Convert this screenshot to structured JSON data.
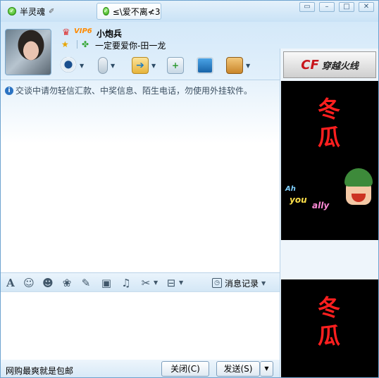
{
  "tabs": [
    {
      "label": "半灵魂",
      "icon": "online-status-icon",
      "extra": "✐"
    },
    {
      "label": "≤\\爱不离≮3",
      "icon": "online-status-icon"
    }
  ],
  "window_controls": [
    "restore-icon",
    "minimize-icon",
    "maximize-icon",
    "close-icon"
  ],
  "contact": {
    "vip_badge": "VIP6",
    "nickname": "小炮兵",
    "signature": "一定要爱你-田一龙"
  },
  "notice": "交谈中请勿轻信汇款、中奖信息、陌生电话，勿使用外挂软件。",
  "input_toolbar": {
    "history_label": "消息记录"
  },
  "footer": {
    "ad_text": "网购最爽就是包邮",
    "close_label": "关闭(C)",
    "send_label": "发送(S)",
    "send_dropdown": "▼"
  },
  "sidebar": {
    "banner_logo": "CF",
    "banner_name": "穿越火线",
    "gif_text": [
      "冬",
      "瓜"
    ],
    "gif_caption_1": "Ah",
    "gif_caption_2": "you",
    "gif_caption_3": "ally"
  },
  "colors": {
    "online": "#2fa80e",
    "vip": "#ff8a00",
    "banner_red": "#c8151b",
    "gif_text_red": "#ff1f1f"
  }
}
